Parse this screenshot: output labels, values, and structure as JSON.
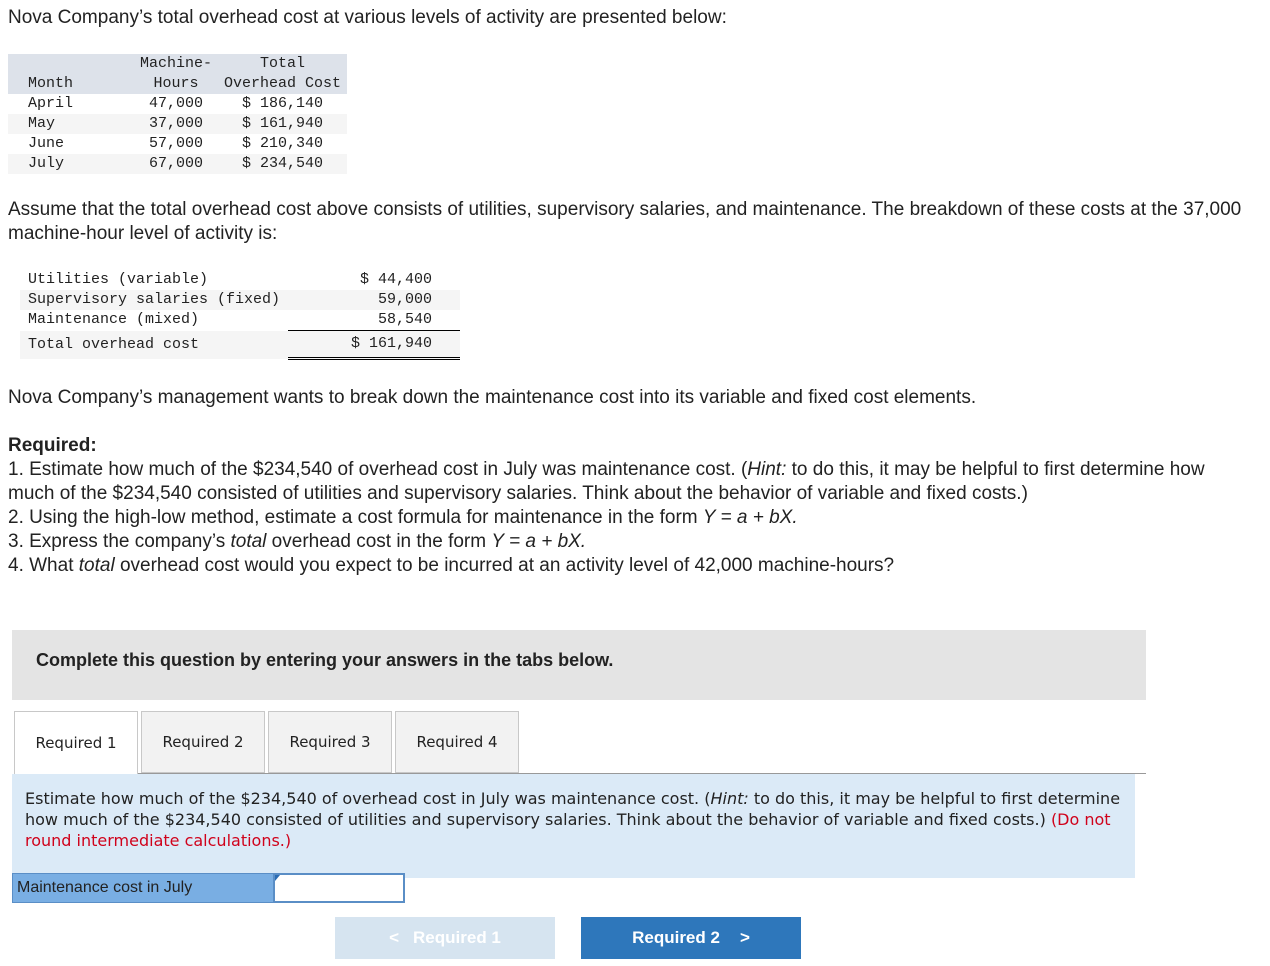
{
  "intro": "Nova Company’s total overhead cost at various levels of activity are presented below:",
  "table1": {
    "headers": [
      [
        "",
        "Machine-",
        "Total"
      ],
      [
        "Month",
        "Hours",
        "Overhead Cost"
      ]
    ],
    "rows": [
      [
        "April",
        "47,000",
        "$ 186,140"
      ],
      [
        "May",
        "37,000",
        "$ 161,940"
      ],
      [
        "June",
        "57,000",
        "$ 210,340"
      ],
      [
        "July",
        "67,000",
        "$ 234,540"
      ]
    ]
  },
  "assume": "Assume that the total overhead cost above consists of utilities, supervisory salaries, and maintenance. The breakdown of these costs at the 37,000 machine-hour level of activity is:",
  "table2": {
    "rows": [
      [
        "Utilities (variable)",
        "$ 44,400"
      ],
      [
        "Supervisory salaries (fixed)",
        "59,000"
      ],
      [
        "Maintenance (mixed)",
        "58,540"
      ]
    ],
    "total": [
      "Total overhead cost",
      "$ 161,940"
    ]
  },
  "mgmt": "Nova Company’s management wants to break down the maintenance cost into its variable and fixed cost elements.",
  "required_title": "Required:",
  "req1a": "1. Estimate how much of the $234,540 of overhead cost in July was maintenance cost. (",
  "hint": "Hint:",
  "req1b": " to do this, it may be helpful to first determine how much of the $234,540 consisted of utilities and supervisory salaries. Think about the behavior of variable and fixed costs.)",
  "req2a": "2. Using the high-low method, estimate a cost formula for maintenance in the form ",
  "formula": "Y = a + bX.",
  "req3a": "3. Express the company’s ",
  "total_word": "total",
  "req3b": " overhead cost in the form ",
  "req4a": "4. What ",
  "req4b": " overhead cost would you expect to be incurred at an activity level of 42,000 machine-hours?",
  "complete_banner": "Complete this question by entering your answers in the tabs below.",
  "tabs": [
    "Required 1",
    "Required 2",
    "Required 3",
    "Required 4"
  ],
  "instr_a": "Estimate how much of the $234,540 of overhead cost in July was maintenance cost. (",
  "instr_b": " to do this, it may be helpful to first determine how much of the $234,540 consisted of utilities and supervisory salaries. Think about the behavior of variable and fixed costs.) ",
  "instr_red": "(Do not round intermediate calculations.)",
  "input_label": "Maintenance cost in July",
  "input_value": "",
  "prev_label": "Required 1",
  "next_label": "Required 2"
}
